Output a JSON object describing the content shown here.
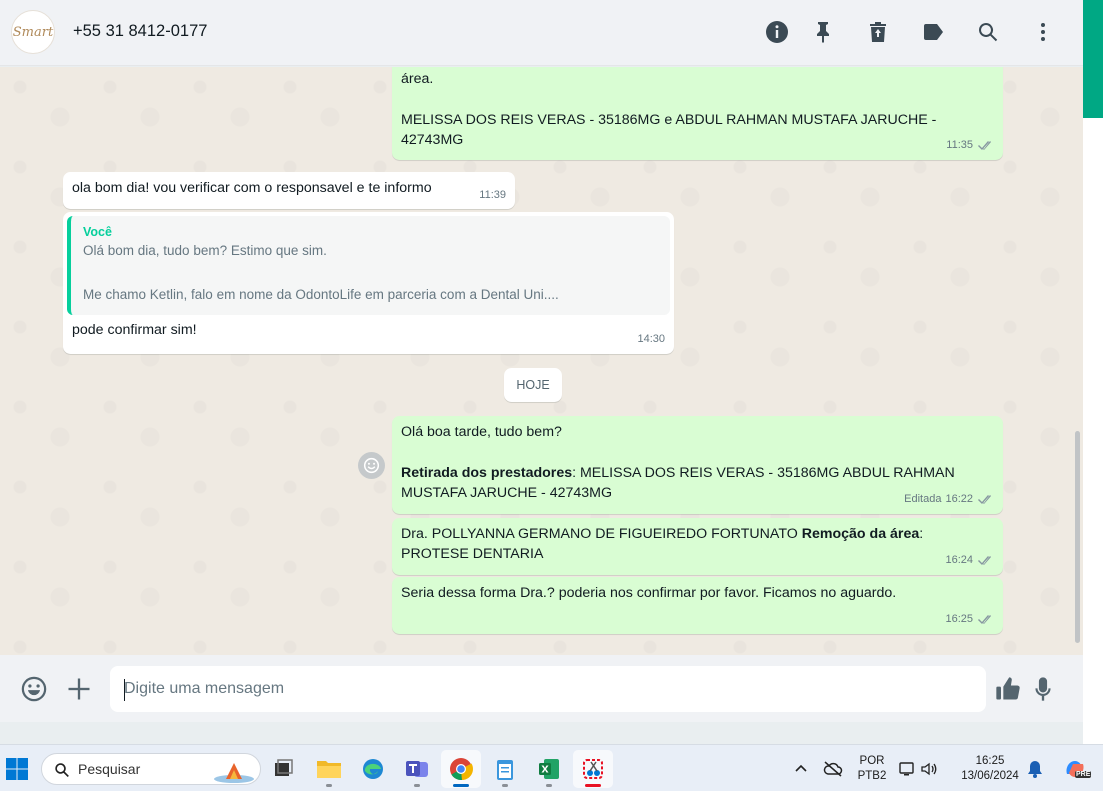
{
  "header": {
    "avatar_text": "Smart",
    "contact": "+55 31 8412-0177",
    "icons": [
      "info-icon",
      "pin-icon",
      "delete-icon",
      "label-icon",
      "search-icon",
      "menu-icon"
    ]
  },
  "messages": [
    {
      "dir": "out",
      "lines": [
        "área.",
        "",
        "MELISSA DOS REIS VERAS - 35186MG   e   ABDUL RAHMAN MUSTAFA JARUCHE -",
        "42743MG"
      ],
      "time": "11:35"
    },
    {
      "dir": "in",
      "text": "ola bom dia! vou verificar com o responsavel e te informo",
      "time": "11:39"
    },
    {
      "dir": "in",
      "quote": {
        "author": "Você",
        "line1": "Olá bom dia, tudo bem? Estimo que sim.",
        "line2": "Me chamo Ketlin, falo em nome da OdontoLife em parceria com a Dental Uni...."
      },
      "text": "pode confirmar sim!",
      "time": "14:30"
    },
    {
      "dir": "out",
      "greeting": "Olá boa tarde, tudo bem?",
      "bold": "Retirada dos prestadores",
      "rest1": ": MELISSA DOS REIS VERAS - 35186MG   ABDUL RAHMAN",
      "rest2": "MUSTAFA JARUCHE - 42743MG",
      "edited": "Editada",
      "time": "16:22"
    },
    {
      "dir": "out",
      "pre": "Dra. POLLYANNA GERMANO DE FIGUEIREDO FORTUNATO ",
      "bold": "Remoção da área",
      "post": ":",
      "line2": "PROTESE DENTARIA",
      "time": "16:24"
    },
    {
      "dir": "out",
      "text": "Seria dessa forma Dra.? poderia nos confirmar por favor. Ficamos no aguardo.",
      "time": "16:25"
    }
  ],
  "date_chip": "HOJE",
  "composer": {
    "placeholder": "Digite uma mensagem"
  },
  "taskbar": {
    "search_placeholder": "Pesquisar",
    "lang1": "POR",
    "lang2": "PTB2",
    "time": "16:25",
    "date": "13/06/2024",
    "copilot_badge": "PRE"
  }
}
